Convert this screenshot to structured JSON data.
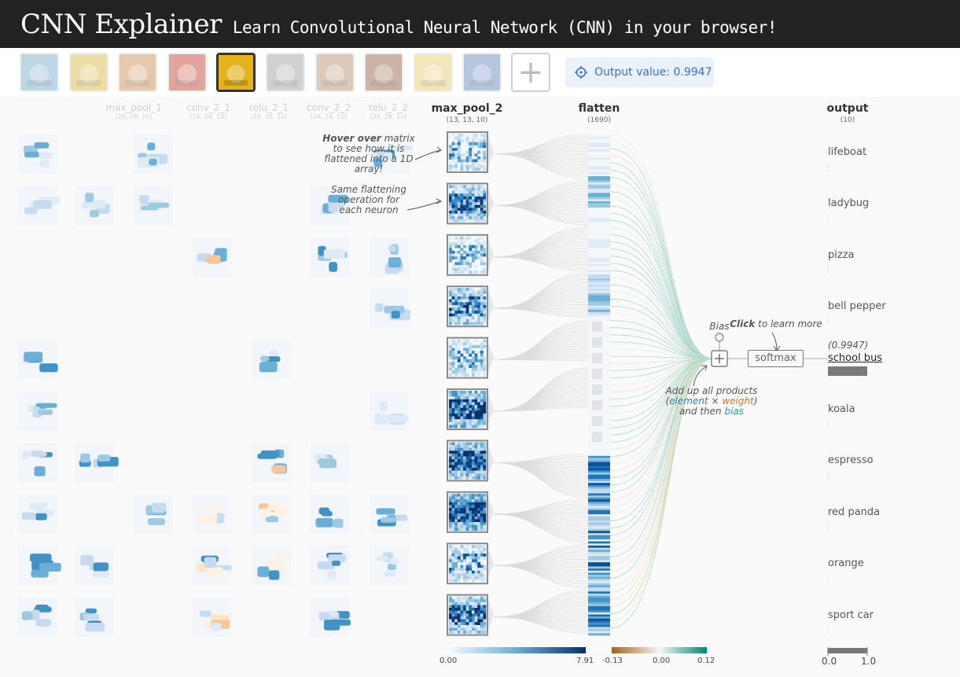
{
  "header": {
    "title": "CNN Explainer",
    "subtitle": "Learn Convolutional Neural Network (CNN) in your browser!"
  },
  "toolbar": {
    "add_label": "+",
    "output_value_label": "Output value: 0.9947",
    "images": [
      {
        "name": "lifeboat",
        "color": "#6fa7c9"
      },
      {
        "name": "ladybug",
        "color": "#d7b23a"
      },
      {
        "name": "pizza",
        "color": "#c98a4a"
      },
      {
        "name": "bell pepper",
        "color": "#c0392b"
      },
      {
        "name": "school bus",
        "color": "#e3b21c"
      },
      {
        "name": "koala",
        "color": "#9a9a9a"
      },
      {
        "name": "espresso",
        "color": "#b08968"
      },
      {
        "name": "red panda",
        "color": "#8d5a3a"
      },
      {
        "name": "orange",
        "color": "#e6c86a"
      },
      {
        "name": "sport car",
        "color": "#5e7fb8"
      }
    ],
    "selected_index": 4
  },
  "layers": {
    "ghost": [
      {
        "name": "max_pool_1",
        "dim": "(28, 28, 10)"
      },
      {
        "name": "conv_2_1",
        "dim": "(26, 26, 10)"
      },
      {
        "name": "relu_2_1",
        "dim": "(26, 26, 10)"
      },
      {
        "name": "conv_2_2",
        "dim": "(24, 24, 10)"
      },
      {
        "name": "relu_2_2",
        "dim": "(26, 26, 10)"
      }
    ],
    "max_pool_2": {
      "name": "max_pool_2",
      "dim": "(13, 13, 10)"
    },
    "flatten": {
      "name": "flatten",
      "dim": "(1690)"
    },
    "output": {
      "name": "output",
      "dim": "(10)"
    }
  },
  "annotations": {
    "hover_bold": "Hover over",
    "hover_rest": " matrix to see how it is flattened into a 1D array!",
    "same_flatten": "Same flattening operation for each neuron",
    "bias_label": "Bias",
    "click_bold": "Click",
    "click_rest": " to learn more",
    "softmax_label": "softmax",
    "add_line1": "Add up all products",
    "add_element": "element",
    "add_times": " × ",
    "add_weight": "weight",
    "add_then": "and then ",
    "add_bias": "bias"
  },
  "output": {
    "classes": [
      "lifeboat",
      "ladybug",
      "pizza",
      "bell pepper",
      "school bus",
      "koala",
      "espresso",
      "red panda",
      "orange",
      "sport car"
    ],
    "selected": "school bus",
    "selected_value": "(0.9947)",
    "selected_index": 4
  },
  "legends": {
    "blue": {
      "min": "0.00",
      "max": "7.91"
    },
    "diverging": {
      "min": "-0.13",
      "mid": "0.00",
      "max": "0.12"
    },
    "prob": {
      "min": "0.0",
      "max": "1.0"
    }
  },
  "colors": {
    "header_bg": "#222222",
    "accent_blue": "#3a6fc4",
    "weight_blue": "#2c7fb8",
    "weight_orange": "#c17a2b"
  }
}
